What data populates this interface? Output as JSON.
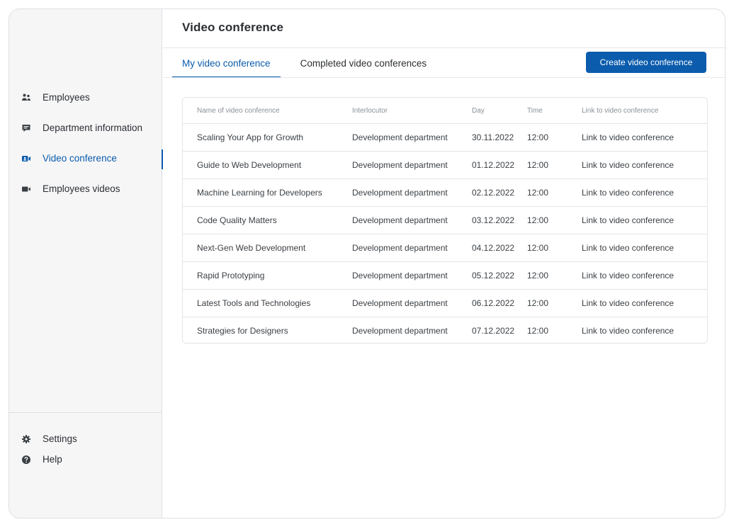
{
  "sidebar": {
    "items": [
      {
        "label": "Employees",
        "icon": "users-icon"
      },
      {
        "label": "Department information",
        "icon": "chat-info-icon"
      },
      {
        "label": "Video conference",
        "icon": "video-conference-icon"
      },
      {
        "label": "Employees videos",
        "icon": "video-camera-icon"
      }
    ],
    "active_index": 2,
    "bottom": [
      {
        "label": "Settings",
        "icon": "gear-icon"
      },
      {
        "label": "Help",
        "icon": "help-icon"
      }
    ]
  },
  "header": {
    "title": "Video conference"
  },
  "tabs": [
    {
      "label": "My video conference",
      "active": true
    },
    {
      "label": "Completed video conferences",
      "active": false
    }
  ],
  "create_button": "Create video conference",
  "table": {
    "columns": [
      "Name of video conference",
      "Interlocutor",
      "Day",
      "Time",
      "Link to video conference"
    ],
    "rows": [
      [
        "Scaling Your App for Growth",
        "Development department",
        "30.11.2022",
        "12:00",
        "Link to video conference"
      ],
      [
        "Guide to Web Development",
        "Development department",
        "01.12.2022",
        "12:00",
        "Link to video conference"
      ],
      [
        "Machine Learning for Developers",
        "Development department",
        "02.12.2022",
        "12:00",
        "Link to video conference"
      ],
      [
        "Code Quality Matters",
        "Development department",
        "03.12.2022",
        "12:00",
        "Link to video conference"
      ],
      [
        "Next-Gen Web Development",
        "Development department",
        "04.12.2022",
        "12:00",
        "Link to video conference"
      ],
      [
        "Rapid Prototyping",
        "Development department",
        "05.12.2022",
        "12:00",
        "Link to video conference"
      ],
      [
        "Latest Tools and Technologies",
        "Development department",
        "06.12.2022",
        "12:00",
        "Link to video conference"
      ],
      [
        "Strategies for Designers",
        "Development department",
        "07.12.2022",
        "12:00",
        "Link to video conference"
      ]
    ]
  },
  "colors": {
    "accent": "#0b5cad",
    "sidebar_bg": "#f6f6f7",
    "border": "#dcdfe3"
  }
}
